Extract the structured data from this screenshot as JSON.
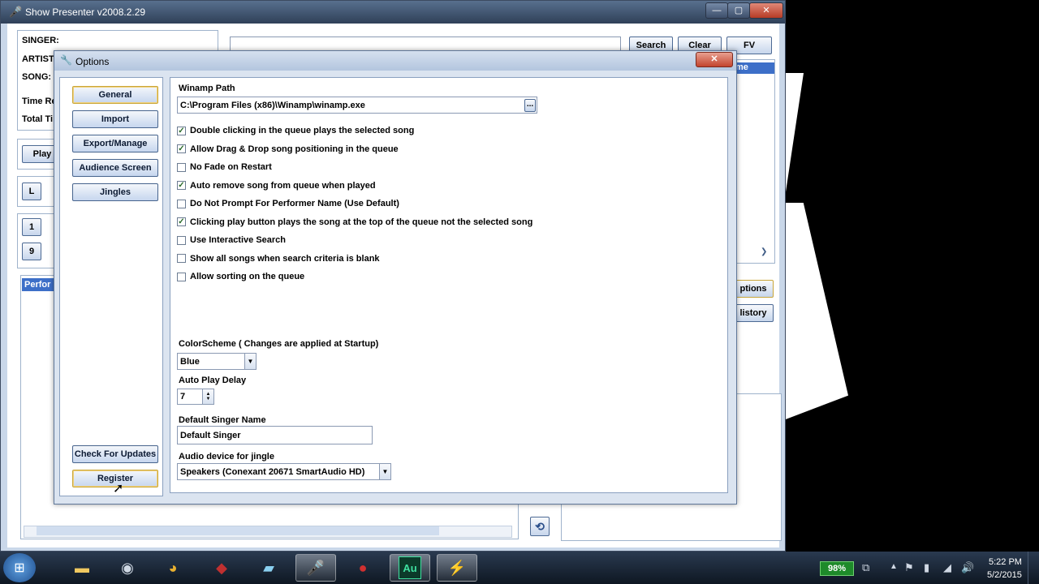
{
  "main_window": {
    "title": "Show Presenter v2008.2.29",
    "controls": {
      "minimize": "—",
      "maximize": "▢",
      "close": "✕"
    },
    "info_labels": [
      "SINGER:",
      "ARTIST",
      "SONG:",
      "Time Re",
      "Total Ti"
    ],
    "search_button": "Search",
    "clear_button": "Clear",
    "fv_button": "FV",
    "play_button": "Play",
    "l_button": "L",
    "num_buttons": [
      "1",
      "9"
    ],
    "list_header_left": "Perfor",
    "list_header_right": "me",
    "options_button": "ptions",
    "history_button": "listory"
  },
  "options": {
    "title": "Options",
    "close_label": "✕",
    "nav": [
      "General",
      "Import",
      "Export/Manage",
      "Audience Screen",
      "Jingles"
    ],
    "check_updates": "Check For Updates",
    "register": "Register",
    "winamp_label": "Winamp Path",
    "winamp_path": "C:\\Program Files (x86)\\Winamp\\winamp.exe",
    "browse_label": "...",
    "checkboxes": [
      {
        "label": "Double clicking in the queue plays the selected song",
        "checked": true
      },
      {
        "label": "Allow Drag & Drop song positioning in the queue",
        "checked": true
      },
      {
        "label": "No Fade on Restart",
        "checked": false
      },
      {
        "label": "Auto remove song from queue when played",
        "checked": true
      },
      {
        "label": "Do Not  Prompt For Performer Name (Use Default)",
        "checked": false
      },
      {
        "label": "Clicking play button plays the song at the top of the queue not the selected song",
        "checked": true
      },
      {
        "label": "Use Interactive Search",
        "checked": false
      },
      {
        "label": "Show all songs when search criteria is blank",
        "checked": false
      },
      {
        "label": "Allow sorting on the queue",
        "checked": false
      }
    ],
    "color_scheme_label": "ColorScheme ( Changes are applied at Startup)",
    "color_scheme_value": "Blue",
    "auto_play_label": "Auto Play Delay",
    "auto_play_value": "7",
    "default_singer_label": "Default Singer Name",
    "default_singer_value": "Default Singer",
    "audio_device_label": "Audio device for jingle",
    "audio_device_value": "Speakers (Conexant 20671 SmartAudio HD)"
  },
  "taskbar": {
    "battery": "98%",
    "time": "5:22 PM",
    "date": "5/2/2015",
    "au_label": "Au"
  },
  "colors": {
    "accent": "#3d6fc8",
    "taskbar": "#0e1722",
    "window_frame": "#2f4058"
  }
}
